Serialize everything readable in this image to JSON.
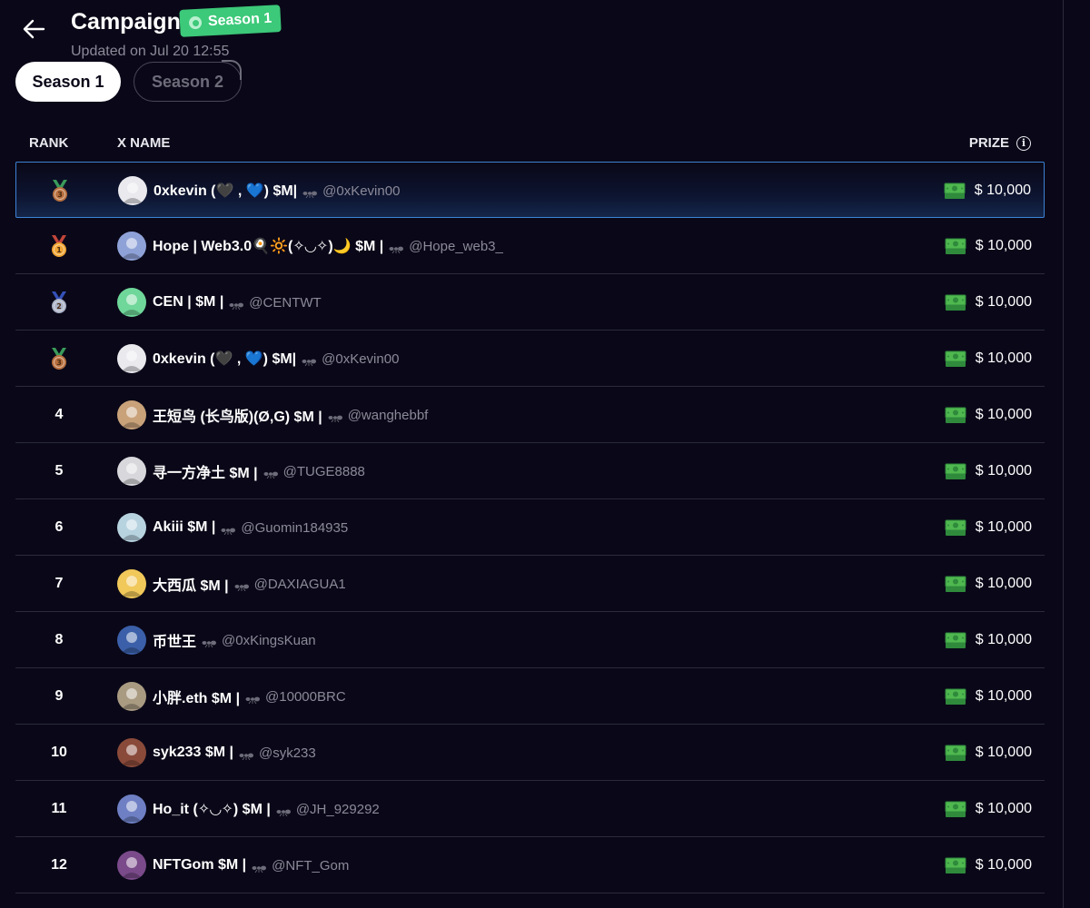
{
  "header": {
    "title": "Campaign",
    "badge": "Season 1",
    "updated": "Updated on Jul 20 12:55"
  },
  "tabs": [
    {
      "label": "Season 1",
      "active": true
    },
    {
      "label": "Season 2",
      "active": false
    }
  ],
  "table": {
    "columns": {
      "rank": "RANK",
      "name": "X NAME",
      "prize": "PRIZE"
    },
    "rows": [
      {
        "rank": "",
        "medal": "bronze",
        "name": "0xkevin (🖤 , 💙) $M|",
        "handle": "@0xKevin00",
        "prize": "$ 10,000",
        "highlight": true,
        "avatar_color": "#e9e9ee"
      },
      {
        "rank": "",
        "medal": "gold",
        "name": "Hope | Web3.0🍳🔆(✧◡✧)🌙 $M |",
        "handle": "@Hope_web3_",
        "prize": "$ 10,000",
        "highlight": false,
        "avatar_color": "#8fa2d8"
      },
      {
        "rank": "",
        "medal": "silver",
        "name": "CEN | $M |",
        "handle": "@CENTWT",
        "prize": "$ 10,000",
        "highlight": false,
        "avatar_color": "#6fd79a"
      },
      {
        "rank": "",
        "medal": "bronze",
        "name": "0xkevin (🖤 , 💙) $M|",
        "handle": "@0xKevin00",
        "prize": "$ 10,000",
        "highlight": false,
        "avatar_color": "#e9e9ee"
      },
      {
        "rank": "4",
        "medal": "",
        "name": "王短鸟 (长鸟版)(Ø,G) $M |",
        "handle": "@wanghebbf",
        "prize": "$ 10,000",
        "highlight": false,
        "avatar_color": "#c9a27a"
      },
      {
        "rank": "5",
        "medal": "",
        "name": "寻一方净土 $M |",
        "handle": "@TUGE8888",
        "prize": "$ 10,000",
        "highlight": false,
        "avatar_color": "#d8d8dc"
      },
      {
        "rank": "6",
        "medal": "",
        "name": "Akiii $M |",
        "handle": "@Guomin184935",
        "prize": "$ 10,000",
        "highlight": false,
        "avatar_color": "#b7d3e0"
      },
      {
        "rank": "7",
        "medal": "",
        "name": "大西瓜 $M |",
        "handle": "@DAXIAGUA1",
        "prize": "$ 10,000",
        "highlight": false,
        "avatar_color": "#f1c85a"
      },
      {
        "rank": "8",
        "medal": "",
        "name": "币世王",
        "handle": "@0xKingsKuan",
        "prize": "$ 10,000",
        "highlight": false,
        "avatar_color": "#3b5fa8"
      },
      {
        "rank": "9",
        "medal": "",
        "name": "小胖.eth $M |",
        "handle": "@10000BRC",
        "prize": "$ 10,000",
        "highlight": false,
        "avatar_color": "#a99a82"
      },
      {
        "rank": "10",
        "medal": "",
        "name": "syk233 $M |",
        "handle": "@syk233",
        "prize": "$ 10,000",
        "highlight": false,
        "avatar_color": "#8a4a3a"
      },
      {
        "rank": "11",
        "medal": "",
        "name": "Ho_it (✧◡✧) $M |",
        "handle": "@JH_929292",
        "prize": "$ 10,000",
        "highlight": false,
        "avatar_color": "#6e7fc4"
      },
      {
        "rank": "12",
        "medal": "",
        "name": "NFTGom $M |",
        "handle": "@NFT_Gom",
        "prize": "$ 10,000",
        "highlight": false,
        "avatar_color": "#7a4a8a"
      }
    ]
  },
  "colors": {
    "background": "#0a0818",
    "badge_green": "#3cc979",
    "highlight_border": "#3d82d4",
    "muted_text": "#8b8a99",
    "medal_gold": "#f0a534",
    "medal_silver": "#aab2c6",
    "medal_bronze": "#b8703f"
  },
  "icons": {
    "back": "arrow-left-icon",
    "info": "info-icon",
    "prize": "money-stack-icon",
    "handle_prefix": "ant-icon"
  }
}
